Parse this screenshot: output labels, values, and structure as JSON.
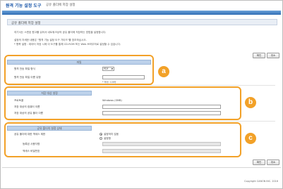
{
  "header": {
    "title": "원격 기능 설정 도구",
    "breadcrumb": "공유 폴더에 저장 설정"
  },
  "section": {
    "title": "공유 폴더에 저장 설정",
    "desc1": "여기서는 스캔된 원고를 읽어서 네트워크상의 공유 폴더에 저장하는 방법을 설정합니다.",
    "desc2": "설정의 자세한 내용은 \"원격 기능 설정 도구 가이드\"를 참조하십시오.",
    "desc3": "* 항목 설명 : 데이터 저장 시에 이 도구를 통해 CD-ROM 또는 Web 브라우저로 설정할 수 있습니다."
  },
  "buttons": {
    "ok": "확인",
    "cancel": "취소"
  },
  "group_a": {
    "header": "파일",
    "file_type_label": "원격 전송 파일 형식",
    "file_type_value": "PDF",
    "file_name_label": "원격 전송 파일 이름 유형",
    "hint": "* 최대: 128자"
  },
  "group_b": {
    "header": "저장 대상 설정",
    "protocol_label": "프로토콜",
    "protocol_value": "Windows (SMB)",
    "host_label": "저장 대상의 컴퓨터 이름",
    "folder_label": "저장 대상의 공유 폴더 이름"
  },
  "group_c": {
    "header": "공유 폴더의 설정 상태",
    "auth_label": "공유 폴더에 대한 액세스 제한",
    "radio_off": "설정하지 않음",
    "radio_on": "설정함",
    "user_label": "등록된 사용자명",
    "password_label": "액세스 비밀번호"
  },
  "badges": {
    "a": "a",
    "b": "b",
    "c": "c"
  },
  "copyright": "Copyright CANON INC. 2016",
  "colors": {
    "accent": "#f2a128",
    "topbar": "#2e6db4",
    "group_header": "#bcd1ea"
  }
}
